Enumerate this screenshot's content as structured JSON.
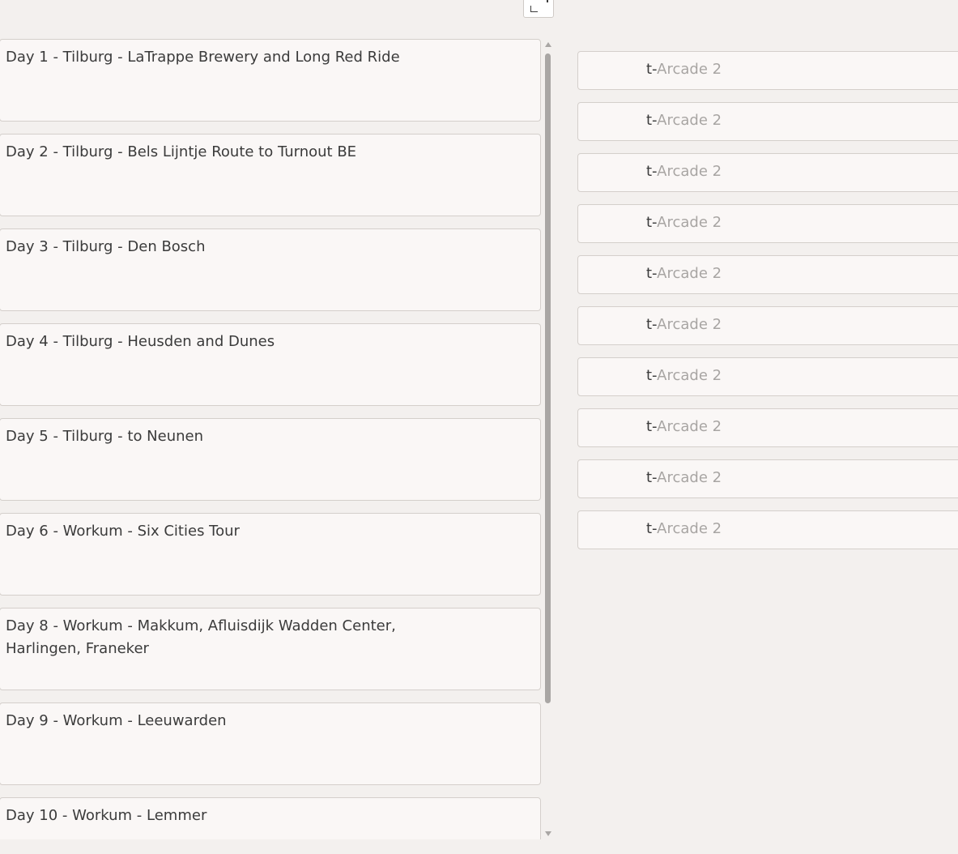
{
  "days": [
    {
      "title": "Day 1 - Tilburg - LaTrappe Brewery and Long Red Ride"
    },
    {
      "title": "Day 2 - Tilburg - Bels Lijntje Route to Turnout BE"
    },
    {
      "title": "Day 3 - Tilburg - Den Bosch"
    },
    {
      "title": "Day 4 - Tilburg - Heusden and Dunes"
    },
    {
      "title": "Day 5 - Tilburg - to Neunen"
    },
    {
      "title": "Day 6 - Workum - Six Cities Tour"
    },
    {
      "title": "Day 8 - Workum - Makkum, Afluisdijk Wadden Center, Harlingen, Franeker"
    },
    {
      "title": "Day 9 - Workum - Leeuwarden"
    },
    {
      "title": "Day 10 - Workum - Lemmer"
    }
  ],
  "arcade_rows": [
    {
      "prefix": "t-",
      "placeholder": "Arcade 2"
    },
    {
      "prefix": "t-",
      "placeholder": "Arcade 2"
    },
    {
      "prefix": "t-",
      "placeholder": "Arcade 2"
    },
    {
      "prefix": "t-",
      "placeholder": "Arcade 2"
    },
    {
      "prefix": "t-",
      "placeholder": "Arcade 2"
    },
    {
      "prefix": "t-",
      "placeholder": "Arcade 2"
    },
    {
      "prefix": "t-",
      "placeholder": "Arcade 2"
    },
    {
      "prefix": "t-",
      "placeholder": "Arcade 2"
    },
    {
      "prefix": "t-",
      "placeholder": "Arcade 2"
    },
    {
      "prefix": "t-",
      "placeholder": "Arcade 2"
    }
  ],
  "icons": {
    "corner_button": "crop-corner-icon",
    "scroll_up": "chevron-up-icon",
    "scroll_down": "chevron-down-icon"
  },
  "colors": {
    "background": "#f3f0ee",
    "card": "#faf7f6",
    "border": "#d4cfcb",
    "text": "#3b3b3b",
    "placeholder": "#a8a5a3",
    "scrollbar": "#a9a6a4"
  }
}
